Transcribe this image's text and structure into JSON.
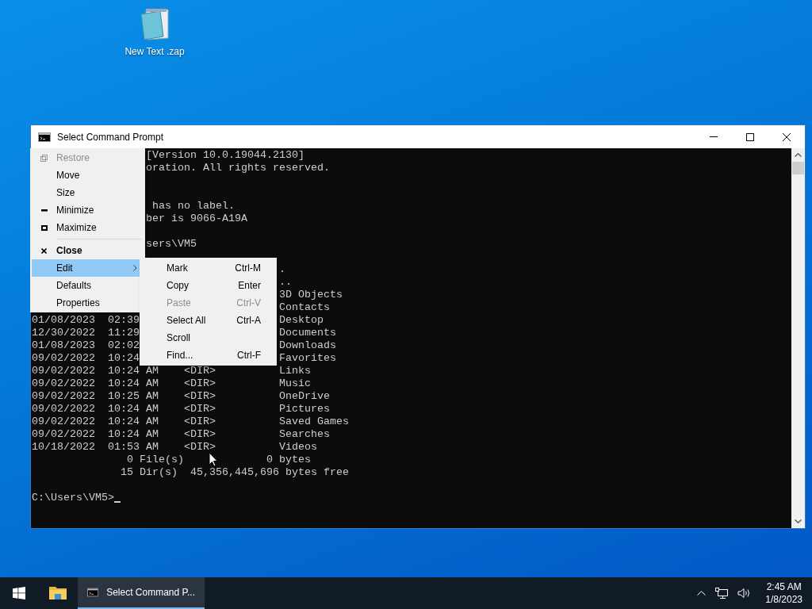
{
  "desktop_icons": [
    {
      "label": "New Text .zap"
    }
  ],
  "window": {
    "title": "Select Command Prompt",
    "console": {
      "lines": [
        {
          "kind": "top",
          "text": "[Version 10.0.19044.2130]"
        },
        {
          "kind": "top",
          "text": "oration. All rights reserved."
        },
        {
          "kind": "blank"
        },
        {
          "kind": "blank"
        },
        {
          "kind": "top",
          "text": " has no label."
        },
        {
          "kind": "top",
          "text": "ber is 9066-A19A"
        },
        {
          "kind": "blank"
        },
        {
          "kind": "top",
          "text": "sers\\VM5"
        },
        {
          "kind": "blank"
        },
        {
          "kind": "mid",
          "text": "."
        },
        {
          "kind": "mid",
          "text": ".."
        },
        {
          "kind": "mid",
          "text": "3D Objects"
        },
        {
          "kind": "mid",
          "text": "Contacts"
        },
        {
          "kind": "split",
          "text": "01/08/2023  02:39",
          "after": "Desktop"
        },
        {
          "kind": "split",
          "text": "12/30/2022  11:29",
          "after": "Documents"
        },
        {
          "kind": "split",
          "text": "01/08/2023  02:02",
          "after": "Downloads"
        },
        {
          "kind": "split",
          "text": "09/02/2022  10:24",
          "after": "Favorites"
        },
        {
          "kind": "full",
          "text": "09/02/2022  10:24 AM    <DIR>          Links"
        },
        {
          "kind": "full",
          "text": "09/02/2022  10:24 AM    <DIR>          Music"
        },
        {
          "kind": "full",
          "text": "09/02/2022  10:25 AM    <DIR>          OneDrive"
        },
        {
          "kind": "full",
          "text": "09/02/2022  10:24 AM    <DIR>          Pictures"
        },
        {
          "kind": "full",
          "text": "09/02/2022  10:24 AM    <DIR>          Saved Games"
        },
        {
          "kind": "full",
          "text": "09/02/2022  10:24 AM    <DIR>          Searches"
        },
        {
          "kind": "full",
          "text": "10/18/2022  01:53 AM    <DIR>          Videos"
        },
        {
          "kind": "counts",
          "text": "               0 File(s)",
          "after": "0 bytes"
        },
        {
          "kind": "full",
          "text": "              15 Dir(s)  45,356,445,696 bytes free"
        },
        {
          "kind": "blank"
        },
        {
          "kind": "prompt",
          "text": "C:\\Users\\VM5>"
        }
      ]
    }
  },
  "system_menu": {
    "items": [
      {
        "kind": "restore",
        "label": "Restore",
        "disabled": true,
        "selected": false
      },
      {
        "kind": "plain",
        "label": "Move",
        "disabled": false,
        "selected": false
      },
      {
        "kind": "plain",
        "label": "Size",
        "disabled": false,
        "selected": false
      },
      {
        "kind": "minimize",
        "label": "Minimize",
        "disabled": false,
        "selected": false
      },
      {
        "kind": "maximize",
        "label": "Maximize",
        "disabled": false,
        "selected": false
      },
      {
        "kind": "separator"
      },
      {
        "kind": "close",
        "label": "Close",
        "disabled": false,
        "selected": false
      },
      {
        "kind": "submenu",
        "label": "Edit",
        "disabled": false,
        "selected": true
      },
      {
        "kind": "plain",
        "label": "Defaults",
        "disabled": false,
        "selected": false
      },
      {
        "kind": "plain",
        "label": "Properties",
        "disabled": false,
        "selected": false
      }
    ]
  },
  "edit_submenu": {
    "items": [
      {
        "label": "Mark",
        "shortcut": "Ctrl-M",
        "disabled": false
      },
      {
        "label": "Copy",
        "shortcut": "Enter",
        "disabled": false
      },
      {
        "label": "Paste",
        "shortcut": "Ctrl-V",
        "disabled": true
      },
      {
        "label": "Select All",
        "shortcut": "Ctrl-A",
        "disabled": false
      },
      {
        "label": "Scroll",
        "disabled": false
      },
      {
        "label": "Find...",
        "shortcut": "Ctrl-F",
        "disabled": false
      }
    ]
  },
  "taskbar": {
    "apps": [
      {
        "kind": "folder",
        "selected": false
      },
      {
        "kind": "console",
        "label": "Select Command P...",
        "selected": true
      }
    ],
    "clock": {
      "time": "2:45 AM",
      "date": "1/8/2023"
    }
  }
}
